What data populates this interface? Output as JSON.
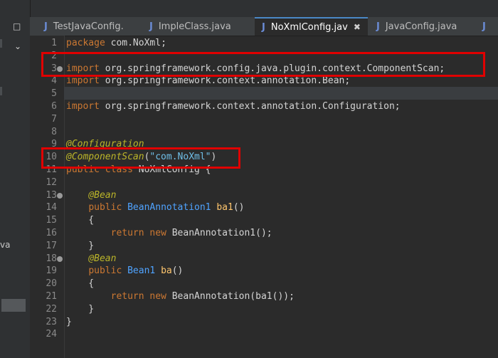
{
  "tabs": [
    {
      "label": "TestJavaConfig.",
      "active": false
    },
    {
      "label": "ImpleClass.java",
      "active": false
    },
    {
      "label": "NoXmlConfig.jav",
      "active": true
    },
    {
      "label": "JavaConfig.java",
      "active": false
    }
  ],
  "left_panel": {
    "text": "va"
  },
  "code_lines": [
    {
      "n": "1",
      "parts": [
        {
          "t": "package",
          "c": "kw"
        },
        {
          "t": " com.NoXml;",
          "c": "plain"
        }
      ]
    },
    {
      "n": "2",
      "parts": []
    },
    {
      "n": "3",
      "parts": [
        {
          "t": "import",
          "c": "kw"
        },
        {
          "t": " org.springframework.config.java.plugin.context.ComponentScan;",
          "c": "plain"
        }
      ]
    },
    {
      "n": "4",
      "parts": [
        {
          "t": "import",
          "c": "kw"
        },
        {
          "t": " org.springframework.context.annotation.Bean;",
          "c": "plain"
        }
      ]
    },
    {
      "n": "5",
      "parts": []
    },
    {
      "n": "6",
      "parts": [
        {
          "t": "import",
          "c": "kw"
        },
        {
          "t": " org.springframework.context.annotation.Configuration;",
          "c": "plain"
        }
      ]
    },
    {
      "n": "7",
      "parts": []
    },
    {
      "n": "8",
      "parts": []
    },
    {
      "n": "9",
      "parts": [
        {
          "t": "@Configuration",
          "c": "ann"
        }
      ]
    },
    {
      "n": "10",
      "parts": [
        {
          "t": "@ComponentScan",
          "c": "ann"
        },
        {
          "t": "(",
          "c": "plain"
        },
        {
          "t": "\"com.NoXml\"",
          "c": "str2"
        },
        {
          "t": ")",
          "c": "plain"
        }
      ]
    },
    {
      "n": "11",
      "parts": [
        {
          "t": "public class",
          "c": "kw"
        },
        {
          "t": " NoXmlConfig {",
          "c": "plain"
        }
      ]
    },
    {
      "n": "12",
      "parts": []
    },
    {
      "n": "13",
      "parts": [
        {
          "t": "    ",
          "c": "plain"
        },
        {
          "t": "@Bean",
          "c": "ann"
        }
      ]
    },
    {
      "n": "14",
      "parts": [
        {
          "t": "    ",
          "c": "plain"
        },
        {
          "t": "public",
          "c": "kw"
        },
        {
          "t": " ",
          "c": "plain"
        },
        {
          "t": "BeanAnnotation1",
          "c": "ty"
        },
        {
          "t": " ",
          "c": "plain"
        },
        {
          "t": "ba1",
          "c": "fn"
        },
        {
          "t": "()",
          "c": "plain"
        }
      ]
    },
    {
      "n": "15",
      "parts": [
        {
          "t": "    {",
          "c": "plain"
        }
      ]
    },
    {
      "n": "16",
      "parts": [
        {
          "t": "        ",
          "c": "plain"
        },
        {
          "t": "return new",
          "c": "kw"
        },
        {
          "t": " BeanAnnotation1();",
          "c": "plain"
        }
      ]
    },
    {
      "n": "17",
      "parts": [
        {
          "t": "    }",
          "c": "plain"
        }
      ]
    },
    {
      "n": "18",
      "parts": [
        {
          "t": "    ",
          "c": "plain"
        },
        {
          "t": "@Bean",
          "c": "ann"
        }
      ]
    },
    {
      "n": "19",
      "parts": [
        {
          "t": "    ",
          "c": "plain"
        },
        {
          "t": "public",
          "c": "kw"
        },
        {
          "t": " ",
          "c": "plain"
        },
        {
          "t": "Bean1",
          "c": "ty"
        },
        {
          "t": " ",
          "c": "plain"
        },
        {
          "t": "ba",
          "c": "fn"
        },
        {
          "t": "()",
          "c": "plain"
        }
      ]
    },
    {
      "n": "20",
      "parts": [
        {
          "t": "    {",
          "c": "plain"
        }
      ]
    },
    {
      "n": "21",
      "parts": [
        {
          "t": "        ",
          "c": "plain"
        },
        {
          "t": "return new",
          "c": "kw"
        },
        {
          "t": " BeanAnnotation(ba1());",
          "c": "plain"
        }
      ]
    },
    {
      "n": "22",
      "parts": [
        {
          "t": "    }",
          "c": "plain"
        }
      ]
    },
    {
      "n": "23",
      "parts": [
        {
          "t": "}",
          "c": "plain"
        }
      ]
    },
    {
      "n": "24",
      "parts": []
    }
  ],
  "colors": {
    "keyword": "#cc7832",
    "annotation": "#bbb529",
    "string": "#6fbfe8",
    "type": "#4fa3ff",
    "highlight_box": "#e00000"
  }
}
